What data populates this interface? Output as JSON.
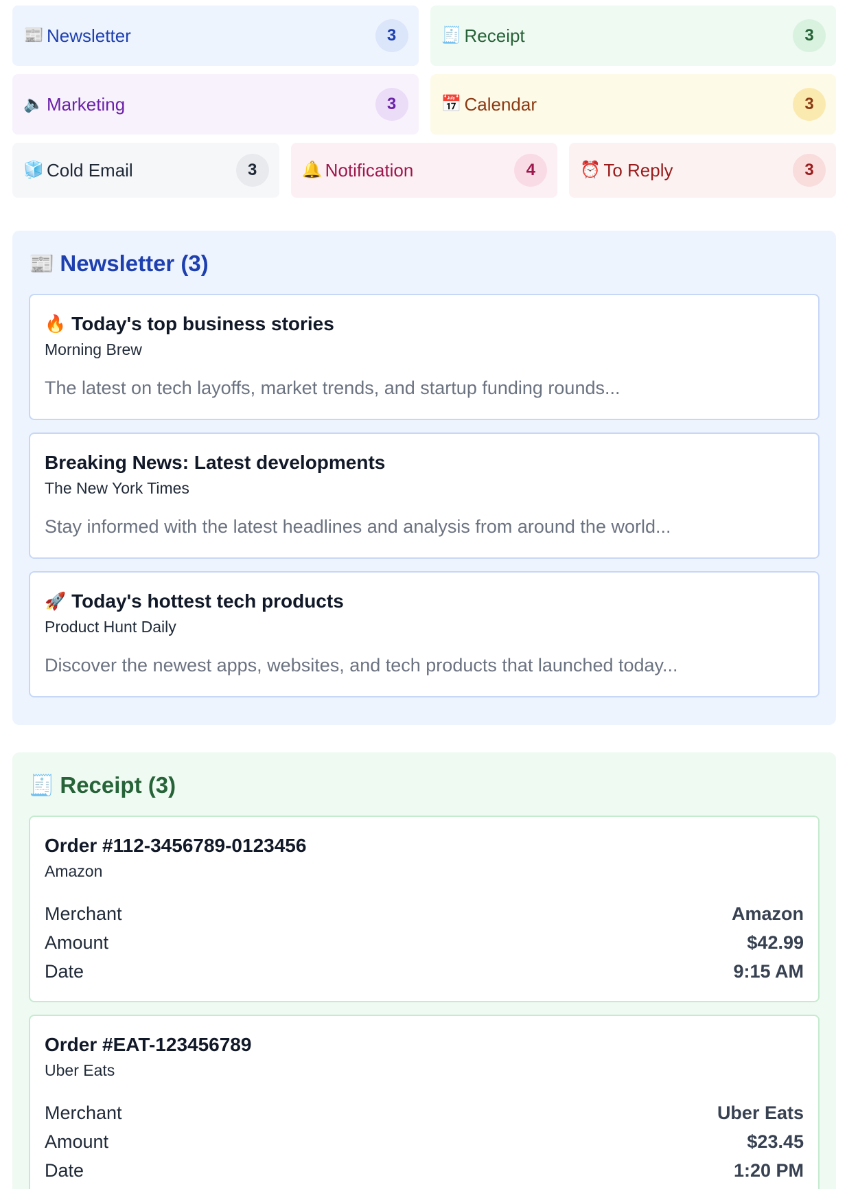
{
  "chips": [
    {
      "icon": "📰",
      "label": "Newsletter",
      "count": "3"
    },
    {
      "icon": "🧾",
      "label": "Receipt",
      "count": "3"
    },
    {
      "icon": "🔈",
      "label": "Marketing",
      "count": "3"
    },
    {
      "icon": "📅",
      "label": "Calendar",
      "count": "3"
    },
    {
      "icon": "🧊",
      "label": "Cold Email",
      "count": "3"
    },
    {
      "icon": "🔔",
      "label": "Notification",
      "count": "4"
    },
    {
      "icon": "⏰",
      "label": "To Reply",
      "count": "3"
    }
  ],
  "newsletter": {
    "icon": "📰",
    "title": "Newsletter (3)",
    "items": [
      {
        "icon": "🔥",
        "title": "Today's top business stories",
        "sender": "Morning Brew",
        "preview": "The latest on tech layoffs, market trends, and startup funding rounds..."
      },
      {
        "icon": "",
        "title": "Breaking News: Latest developments",
        "sender": "The New York Times",
        "preview": "Stay informed with the latest headlines and analysis from around the world..."
      },
      {
        "icon": "🚀",
        "title": "Today's hottest tech products",
        "sender": "Product Hunt Daily",
        "preview": "Discover the newest apps, websites, and tech products that launched today..."
      }
    ]
  },
  "receipt": {
    "icon": "🧾",
    "title": "Receipt (3)",
    "labels": {
      "merchant": "Merchant",
      "amount": "Amount",
      "date": "Date"
    },
    "items": [
      {
        "title": "Order #112-3456789-0123456",
        "sender": "Amazon",
        "merchant": "Amazon",
        "amount": "$42.99",
        "date": "9:15 AM"
      },
      {
        "title": "Order #EAT-123456789",
        "sender": "Uber Eats",
        "merchant": "Uber Eats",
        "amount": "$23.45",
        "date": "1:20 PM"
      }
    ]
  }
}
